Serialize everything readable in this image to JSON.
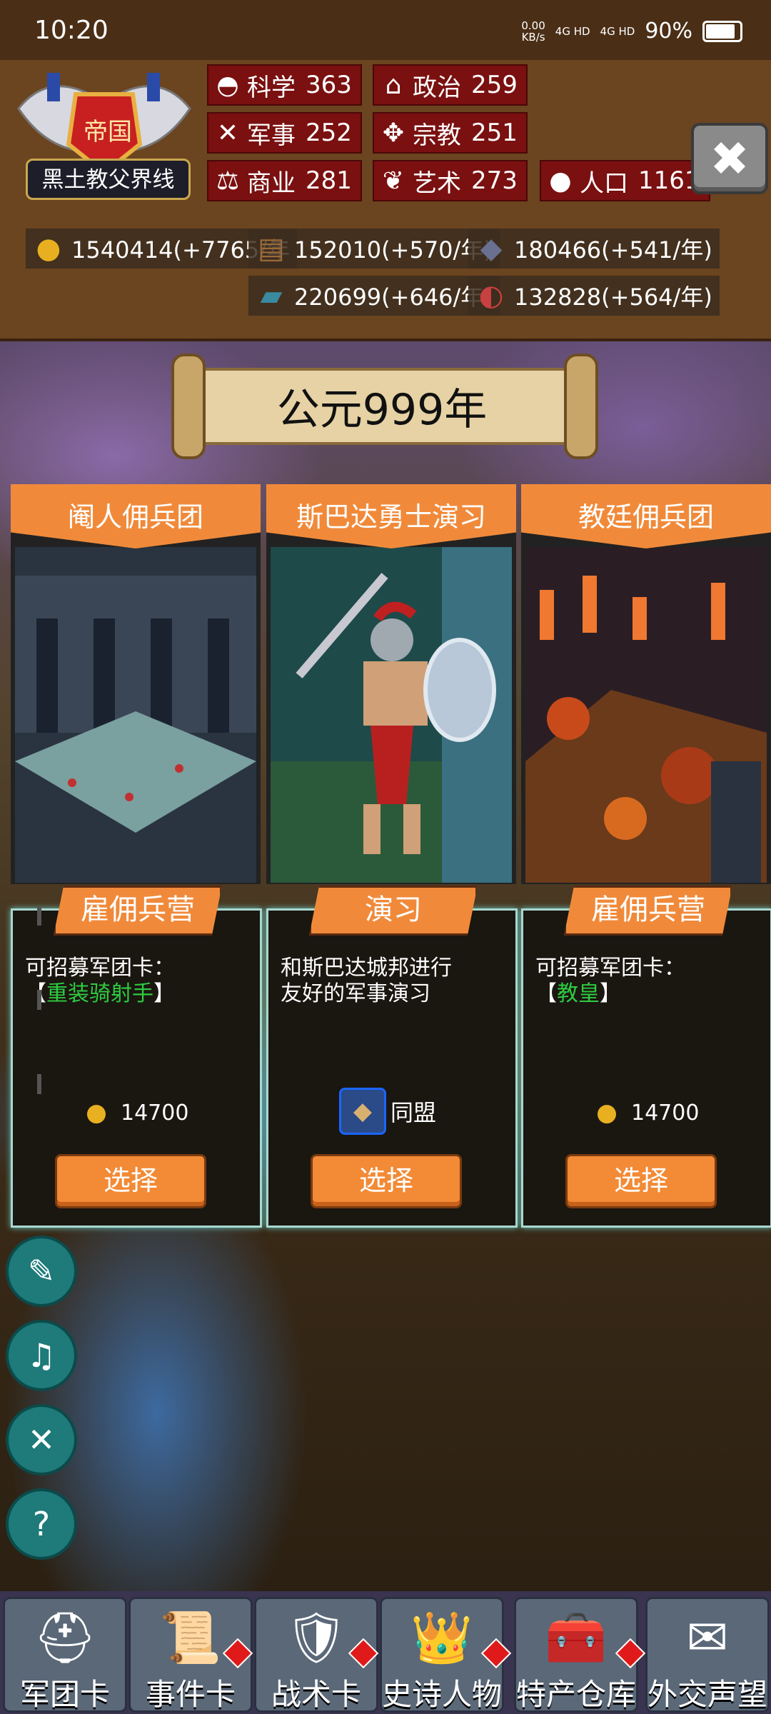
{
  "status": {
    "time": "10:20",
    "speed": "0.00",
    "speed_unit": "KB/s",
    "net1": "4G HD",
    "net2": "4G HD",
    "battery": "90%"
  },
  "emblem": {
    "title": "帝国",
    "name": "黑土教父界线"
  },
  "stats": [
    {
      "icon": "science-icon",
      "glyph": "◓",
      "label": "科学",
      "value": "363"
    },
    {
      "icon": "politics-icon",
      "glyph": "⌂",
      "label": "政治",
      "value": "259"
    },
    {
      "icon": "military-icon",
      "glyph": "✕",
      "label": "军事",
      "value": "252"
    },
    {
      "icon": "religion-icon",
      "glyph": "✥",
      "label": "宗教",
      "value": "251"
    },
    {
      "icon": "commerce-icon",
      "glyph": "⚖",
      "label": "商业",
      "value": "281"
    },
    {
      "icon": "art-icon",
      "glyph": "❦",
      "label": "艺术",
      "value": "273"
    },
    {
      "icon": "population-icon",
      "glyph": "●",
      "label": "人口",
      "value": "1161"
    }
  ],
  "resources": [
    {
      "icon": "gold-icon",
      "glyph": "●",
      "color": "#e8b020",
      "text": "1540414(+7765/年"
    },
    {
      "icon": "wood-icon",
      "glyph": "▤",
      "color": "#9a6a3a",
      "text": "152010(+570/年)"
    },
    {
      "icon": "stone-icon",
      "glyph": "◆",
      "color": "#6a7090",
      "text": "180466(+541/年)"
    },
    {
      "icon": "iron-icon",
      "glyph": "▰",
      "color": "#3a8aa0",
      "text": "220699(+646/年)"
    },
    {
      "icon": "meat-icon",
      "glyph": "◐",
      "color": "#c84040",
      "text": "132828(+564/年)"
    }
  ],
  "year_banner": "公元999年",
  "cards": [
    {
      "title": "阉人佣兵团",
      "tag": "雇佣兵营",
      "desc_line1": "可招募军团卡：",
      "desc_bracket_open": "【",
      "desc_highlight": "重装骑射手",
      "desc_bracket_close": "】",
      "cost": "14700",
      "button": "选择"
    },
    {
      "title": "斯巴达勇士演习",
      "tag": "演习",
      "desc_line1": "和斯巴达城邦进行",
      "desc_line2": "友好的军事演习",
      "alliance": "同盟",
      "button": "选择"
    },
    {
      "title": "教廷佣兵团",
      "tag": "雇佣兵营",
      "desc_line1": "可招募军团卡：",
      "desc_bracket_open": "【",
      "desc_highlight": "教皇",
      "desc_bracket_close": "】",
      "cost": "14700",
      "button": "选择"
    }
  ],
  "side_buttons": [
    {
      "name": "quest-scroll-icon",
      "glyph": "✎"
    },
    {
      "name": "music-icon",
      "glyph": "♫"
    },
    {
      "name": "sound-mute-icon",
      "glyph": "✕"
    },
    {
      "name": "help-icon",
      "glyph": "?"
    }
  ],
  "nav": [
    {
      "label": "军团卡",
      "icon": "helmet-icon",
      "glyph": "⛑",
      "badge": false
    },
    {
      "label": "事件卡",
      "icon": "scroll-icon",
      "glyph": "📜",
      "badge": true
    },
    {
      "label": "战术卡",
      "icon": "shield-icon",
      "glyph": "🛡",
      "badge": true
    },
    {
      "label": "史诗人物",
      "icon": "crown-icon",
      "glyph": "👑",
      "badge": true
    },
    {
      "label": "特产仓库",
      "icon": "chest-icon",
      "glyph": "🧰",
      "badge": true
    },
    {
      "label": "外交声望",
      "icon": "letter-icon",
      "glyph": "✉",
      "badge": false
    }
  ]
}
